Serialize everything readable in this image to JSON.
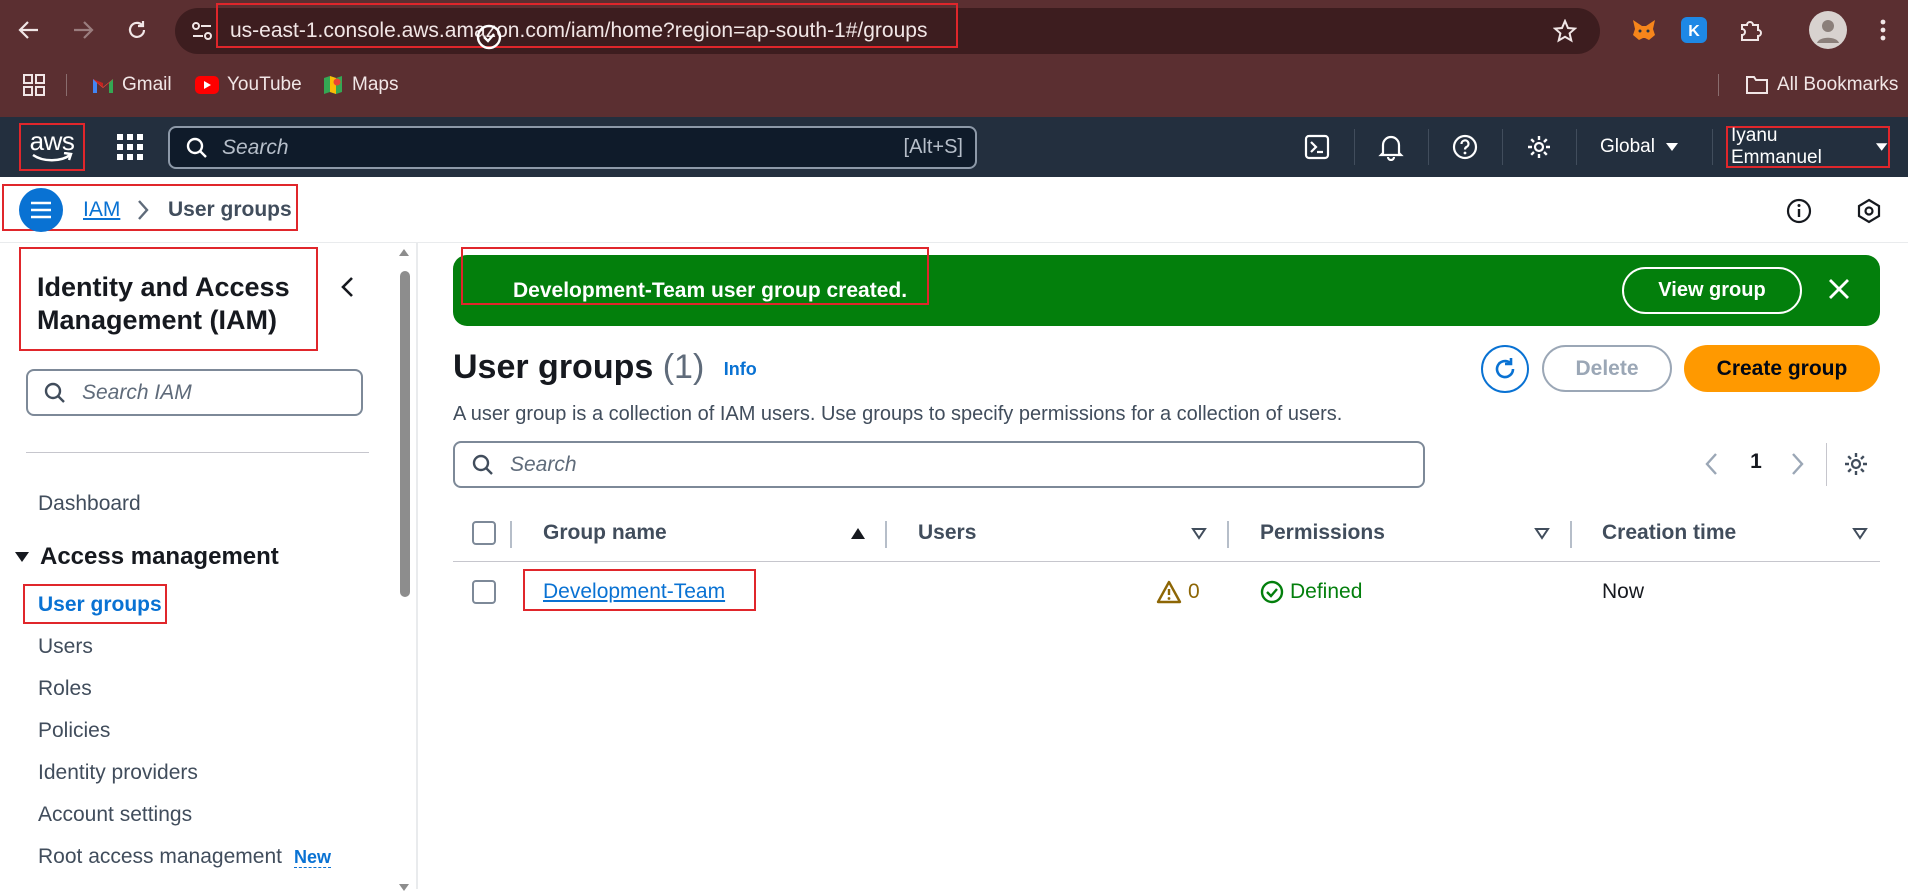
{
  "browser": {
    "url": "us-east-1.console.aws.amazon.com/iam/home?region=ap-south-1#/groups",
    "bookmarks": [
      {
        "label": "Gmail",
        "icon": "gmail-icon"
      },
      {
        "label": "YouTube",
        "icon": "youtube-icon"
      },
      {
        "label": "Maps",
        "icon": "maps-icon"
      }
    ],
    "all_bookmarks_label": "All Bookmarks"
  },
  "aws_nav": {
    "logo_text": "aws",
    "search_placeholder": "Search",
    "search_shortcut": "[Alt+S]",
    "region_label": "Global",
    "account_label": "Iyanu Emmanuel"
  },
  "breadcrumb": {
    "root": "IAM",
    "current": "User groups"
  },
  "sidebar": {
    "title": "Identity and Access Management (IAM)",
    "search_placeholder": "Search IAM",
    "dashboard": "Dashboard",
    "section": "Access management",
    "items": [
      "User groups",
      "Users",
      "Roles",
      "Policies",
      "Identity providers",
      "Account settings",
      "Root access management"
    ],
    "new_badge": "New"
  },
  "flash": {
    "message": "Development-Team user group created.",
    "action": "View group"
  },
  "page": {
    "title": "User groups",
    "count": "(1)",
    "info": "Info",
    "description": "A user group is a collection of IAM users. Use groups to specify permissions for a collection of users.",
    "delete_label": "Delete",
    "create_label": "Create group",
    "search_placeholder": "Search",
    "page_number": "1"
  },
  "table": {
    "columns": [
      "Group name",
      "Users",
      "Permissions",
      "Creation time"
    ],
    "rows": [
      {
        "group_name": "Development-Team",
        "users": "0",
        "permissions": "Defined",
        "creation_time": "Now"
      }
    ]
  },
  "colors": {
    "aws_nav": "#232f3e",
    "link_blue": "#0972d3",
    "flash_green": "#037f0c",
    "primary_orange": "#ff9900",
    "annotation_red": "#e0262b"
  }
}
